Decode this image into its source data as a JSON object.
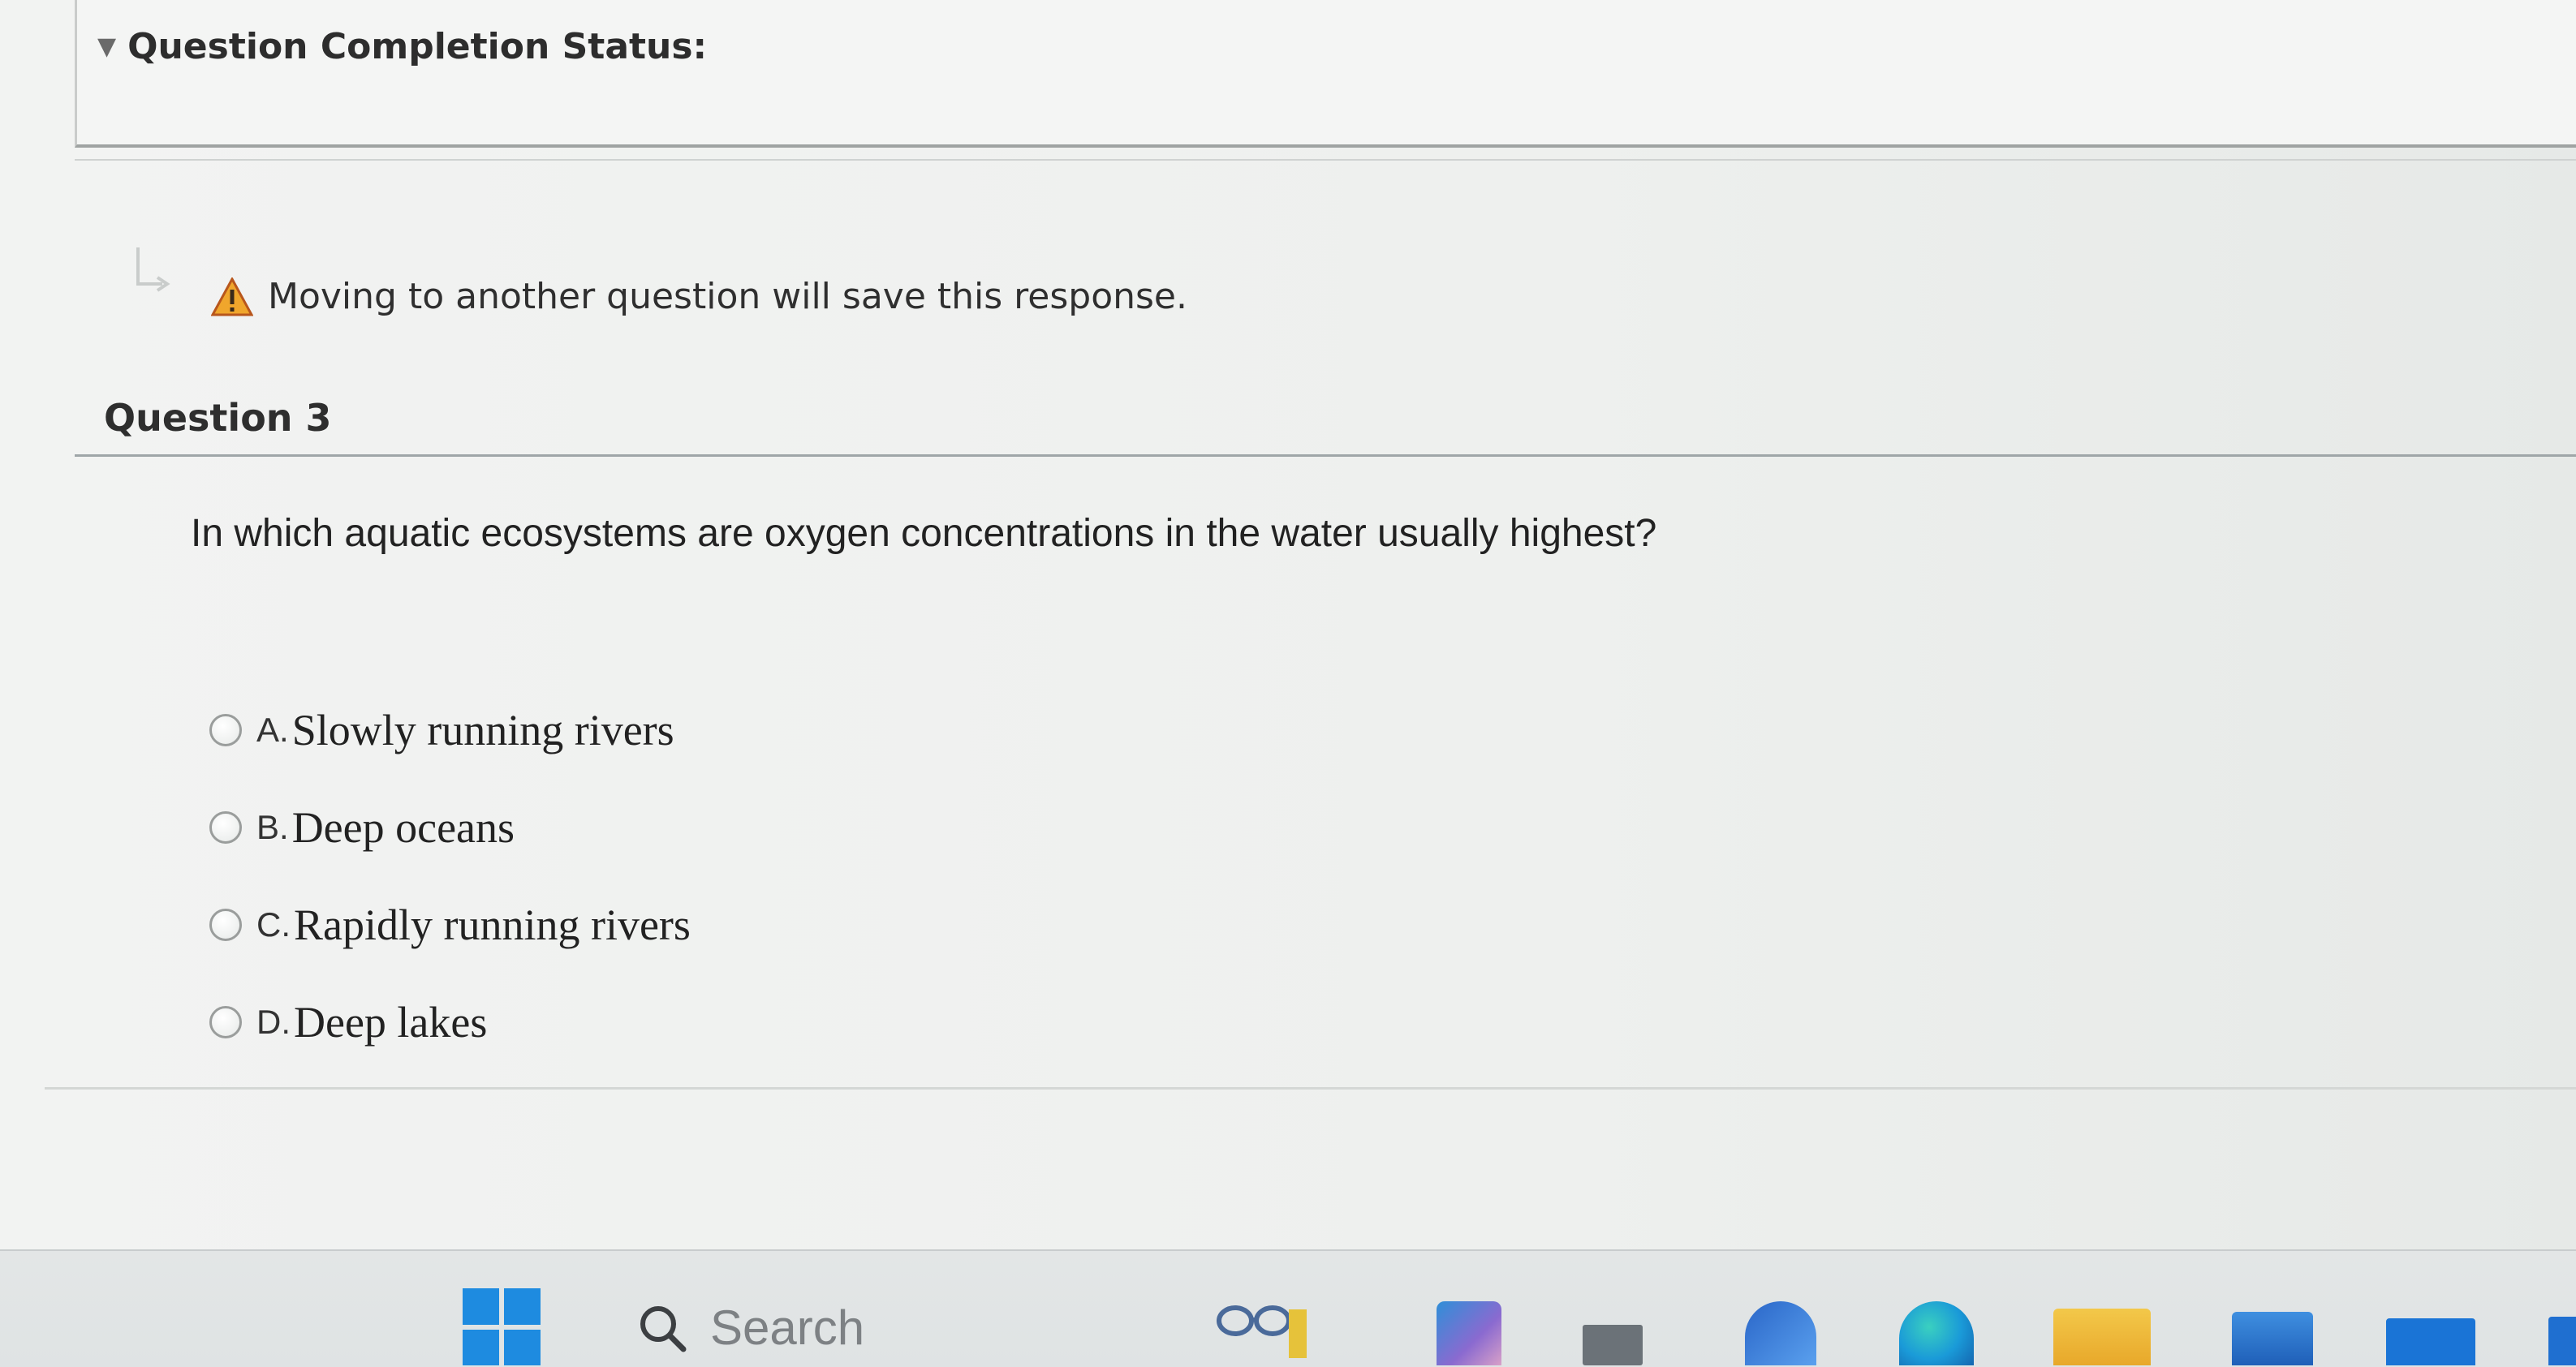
{
  "status": {
    "title": "Question Completion Status:"
  },
  "notice": {
    "text": "Moving to another question will save this response."
  },
  "question": {
    "heading": "Question 3",
    "prompt": "In which aquatic ecosystems are oxygen concentrations in the water usually highest?",
    "answers": [
      {
        "letter": "A.",
        "text": "Slowly running rivers"
      },
      {
        "letter": "B.",
        "text": "Deep oceans"
      },
      {
        "letter": "C.",
        "text": "Rapidly running rivers"
      },
      {
        "letter": "D.",
        "text": "Deep lakes"
      }
    ]
  },
  "taskbar": {
    "search_label": "Search",
    "icons": [
      "windows-start-icon",
      "search-icon",
      "glasses-widget-icon",
      "photos-icon",
      "file-icon",
      "copilot-icon",
      "edge-icon",
      "file-explorer-icon",
      "store-icon",
      "mail-icon"
    ],
    "accent_color": "#1e8be0"
  }
}
